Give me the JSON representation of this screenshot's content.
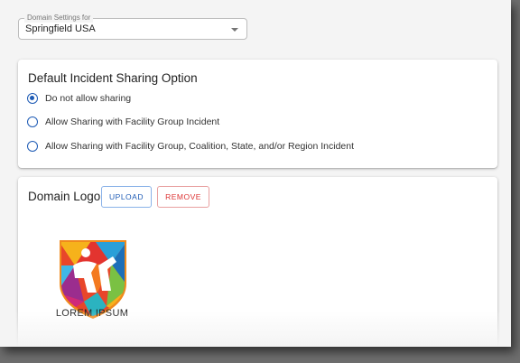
{
  "domain_select": {
    "label": "Domain Settings for",
    "value": "Springfield USA"
  },
  "sharing": {
    "title": "Default Incident Sharing Option",
    "options": [
      {
        "label": "Do not allow sharing",
        "checked": true
      },
      {
        "label": "Allow Sharing with Facility Group Incident",
        "checked": false
      },
      {
        "label": "Allow Sharing with Facility Group, Coalition, State, and/or Region Incident",
        "checked": false
      }
    ]
  },
  "logo_section": {
    "title": "Domain Logo",
    "upload_label": "UPLOAD",
    "remove_label": "REMOVE",
    "logo_caption": "LOREM IPSUM"
  },
  "colors": {
    "accent": "#1e5bb5",
    "remove": "#dd3333"
  }
}
